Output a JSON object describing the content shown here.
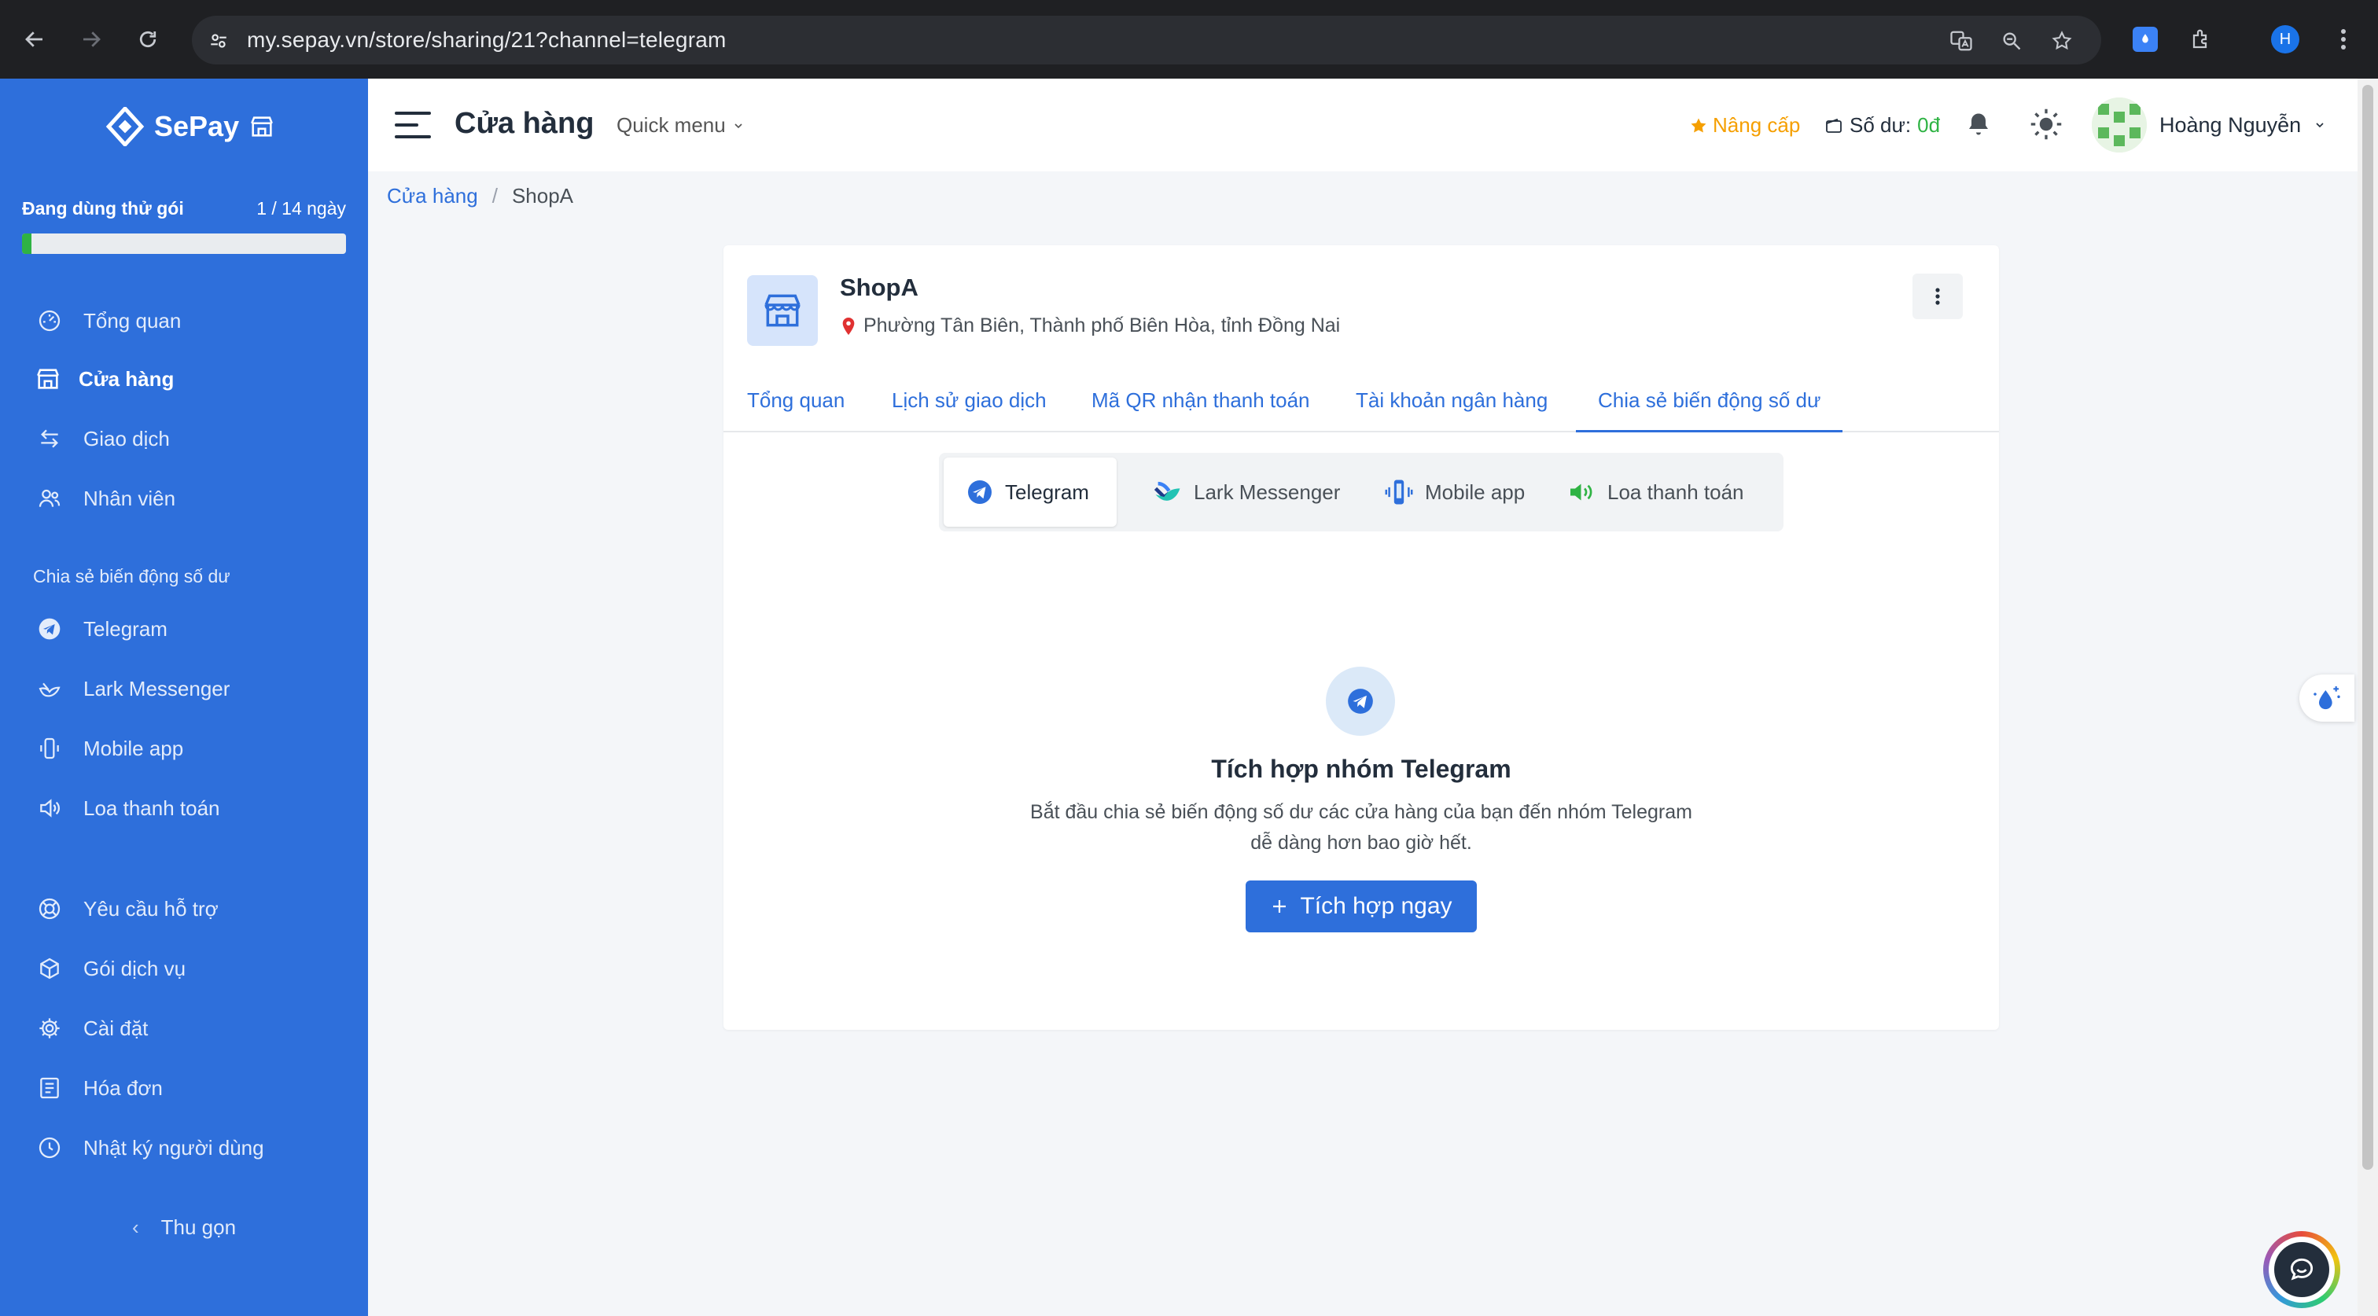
{
  "browser": {
    "url": "my.sepay.vn/store/sharing/21?channel=telegram",
    "profile_initial": "H"
  },
  "sidebar": {
    "brand": "SePay",
    "trial": {
      "label": "Đang dùng thử gói",
      "days": "1 / 14 ngày",
      "progress_percent": 3
    },
    "items": [
      {
        "label": "Tổng quan",
        "icon": "dashboard-icon"
      },
      {
        "label": "Cửa hàng",
        "icon": "store-icon"
      },
      {
        "label": "Giao dịch",
        "icon": "transfer-icon"
      },
      {
        "label": "Nhân viên",
        "icon": "users-icon"
      }
    ],
    "section_label": "Chia sẻ biến động số dư",
    "share_items": [
      {
        "label": "Telegram",
        "icon": "telegram-icon"
      },
      {
        "label": "Lark Messenger",
        "icon": "lark-icon"
      },
      {
        "label": "Mobile app",
        "icon": "mobile-icon"
      },
      {
        "label": "Loa thanh toán",
        "icon": "speaker-icon"
      }
    ],
    "bottom_items": [
      {
        "label": "Yêu cầu hỗ trợ",
        "icon": "lifebuoy-icon"
      },
      {
        "label": "Gói dịch vụ",
        "icon": "package-icon"
      },
      {
        "label": "Cài đặt",
        "icon": "settings-icon"
      },
      {
        "label": "Hóa đơn",
        "icon": "invoice-icon"
      },
      {
        "label": "Nhật ký người dùng",
        "icon": "clock-icon"
      }
    ],
    "collapse_label": "Thu gọn"
  },
  "header": {
    "title": "Cửa hàng",
    "quick_menu": "Quick menu",
    "upgrade": "Nâng cấp",
    "balance_label": "Số dư:",
    "balance_value": "0đ",
    "user_name": "Hoàng Nguyễn"
  },
  "breadcrumb": {
    "root": "Cửa hàng",
    "separator": "/",
    "current": "ShopA"
  },
  "store": {
    "name": "ShopA",
    "address": "Phường Tân Biên, Thành phố Biên Hòa, tỉnh Đồng Nai"
  },
  "tabs": [
    {
      "label": "Tổng quan"
    },
    {
      "label": "Lịch sử giao dịch"
    },
    {
      "label": "Mã QR nhận thanh toán"
    },
    {
      "label": "Tài khoản ngân hàng"
    },
    {
      "label": "Chia sẻ biến động số dư",
      "active": true
    }
  ],
  "channels": [
    {
      "label": "Telegram",
      "active": true
    },
    {
      "label": "Lark Messenger"
    },
    {
      "label": "Mobile app"
    },
    {
      "label": "Loa thanh toán"
    }
  ],
  "empty_state": {
    "title": "Tích hợp nhóm Telegram",
    "desc_line1": "Bắt đầu chia sẻ biến động số dư các cửa hàng của bạn đến nhóm Telegram",
    "desc_line2": "dễ dàng hơn bao giờ hết.",
    "button": "Tích hợp ngay"
  },
  "colors": {
    "primary": "#2e6fdb",
    "success": "#2fb344",
    "warning": "#f59f00"
  }
}
